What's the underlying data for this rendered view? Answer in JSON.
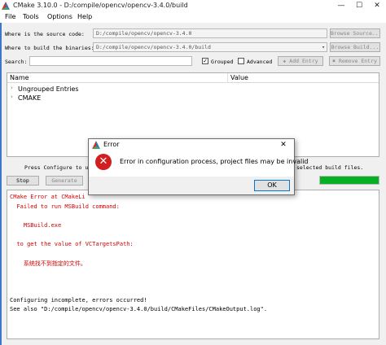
{
  "window": {
    "title": "CMake 3.10.0 - D:/compile/opencv/opencv-3.4.0/build",
    "min_symbol": "—",
    "max_symbol": "☐",
    "close_symbol": "✕"
  },
  "menu": [
    "File",
    "Tools",
    "Options",
    "Help"
  ],
  "source": {
    "label": "Where is the source code:",
    "value": "D:/compile/opencv/opencv-3.4.0",
    "browse": "Browse Source..."
  },
  "build": {
    "label": "Where to build the binaries:",
    "value": "D:/compile/opencv/opencv-3.4.0/build",
    "dropdown_symbol": "▾",
    "browse": "Browse Build..."
  },
  "search": {
    "label": "Search:",
    "value": "",
    "grouped": "Grouped",
    "grouped_checked": "✓",
    "advanced": "Advanced",
    "advanced_checked": "",
    "add_entry": "Add Entry",
    "add_symbol": "✚",
    "remove_entry": "Remove Entry",
    "remove_symbol": "✖"
  },
  "table": {
    "col_name": "Name",
    "col_value": "Value",
    "rows": [
      {
        "arrow": "›",
        "label": "Ungrouped Entries"
      },
      {
        "arrow": "›",
        "label": "CMAKE"
      }
    ]
  },
  "status": {
    "left_text": "Press Configure to u",
    "right_text": "selected build files.",
    "progress": 1.0
  },
  "actions": {
    "stop": "Stop",
    "generate": "Generate"
  },
  "output": {
    "lines": [
      {
        "text": "CMake Error at CMakeLi",
        "color": "red"
      },
      {
        "text": "  Failed to run MSBuild command:",
        "color": "red"
      },
      {
        "text": "",
        "color": "red"
      },
      {
        "text": "    MSBuild.exe",
        "color": "red"
      },
      {
        "text": "",
        "color": "red"
      },
      {
        "text": "  to get the value of VCTargetsPath:",
        "color": "red"
      },
      {
        "text": "",
        "color": "red"
      },
      {
        "text": "    系统找不到指定的文件。",
        "color": "red"
      },
      {
        "text": "",
        "color": "black"
      },
      {
        "text": "",
        "color": "black"
      },
      {
        "text": "",
        "color": "black"
      },
      {
        "text": "Configuring incomplete, errors occurred!",
        "color": "black"
      },
      {
        "text": "See also \"D:/compile/opencv/opencv-3.4.0/build/CMakeFiles/CMakeOutput.log\".",
        "color": "black"
      }
    ]
  },
  "dialog": {
    "title": "Error",
    "close_symbol": "✕",
    "icon_symbol": "✕",
    "message": "Error in configuration process, project files may be invalid",
    "ok": "OK"
  },
  "colors": {
    "error_red": "#d00000",
    "progress_green": "#06b025",
    "ok_border": "#0078d7"
  }
}
